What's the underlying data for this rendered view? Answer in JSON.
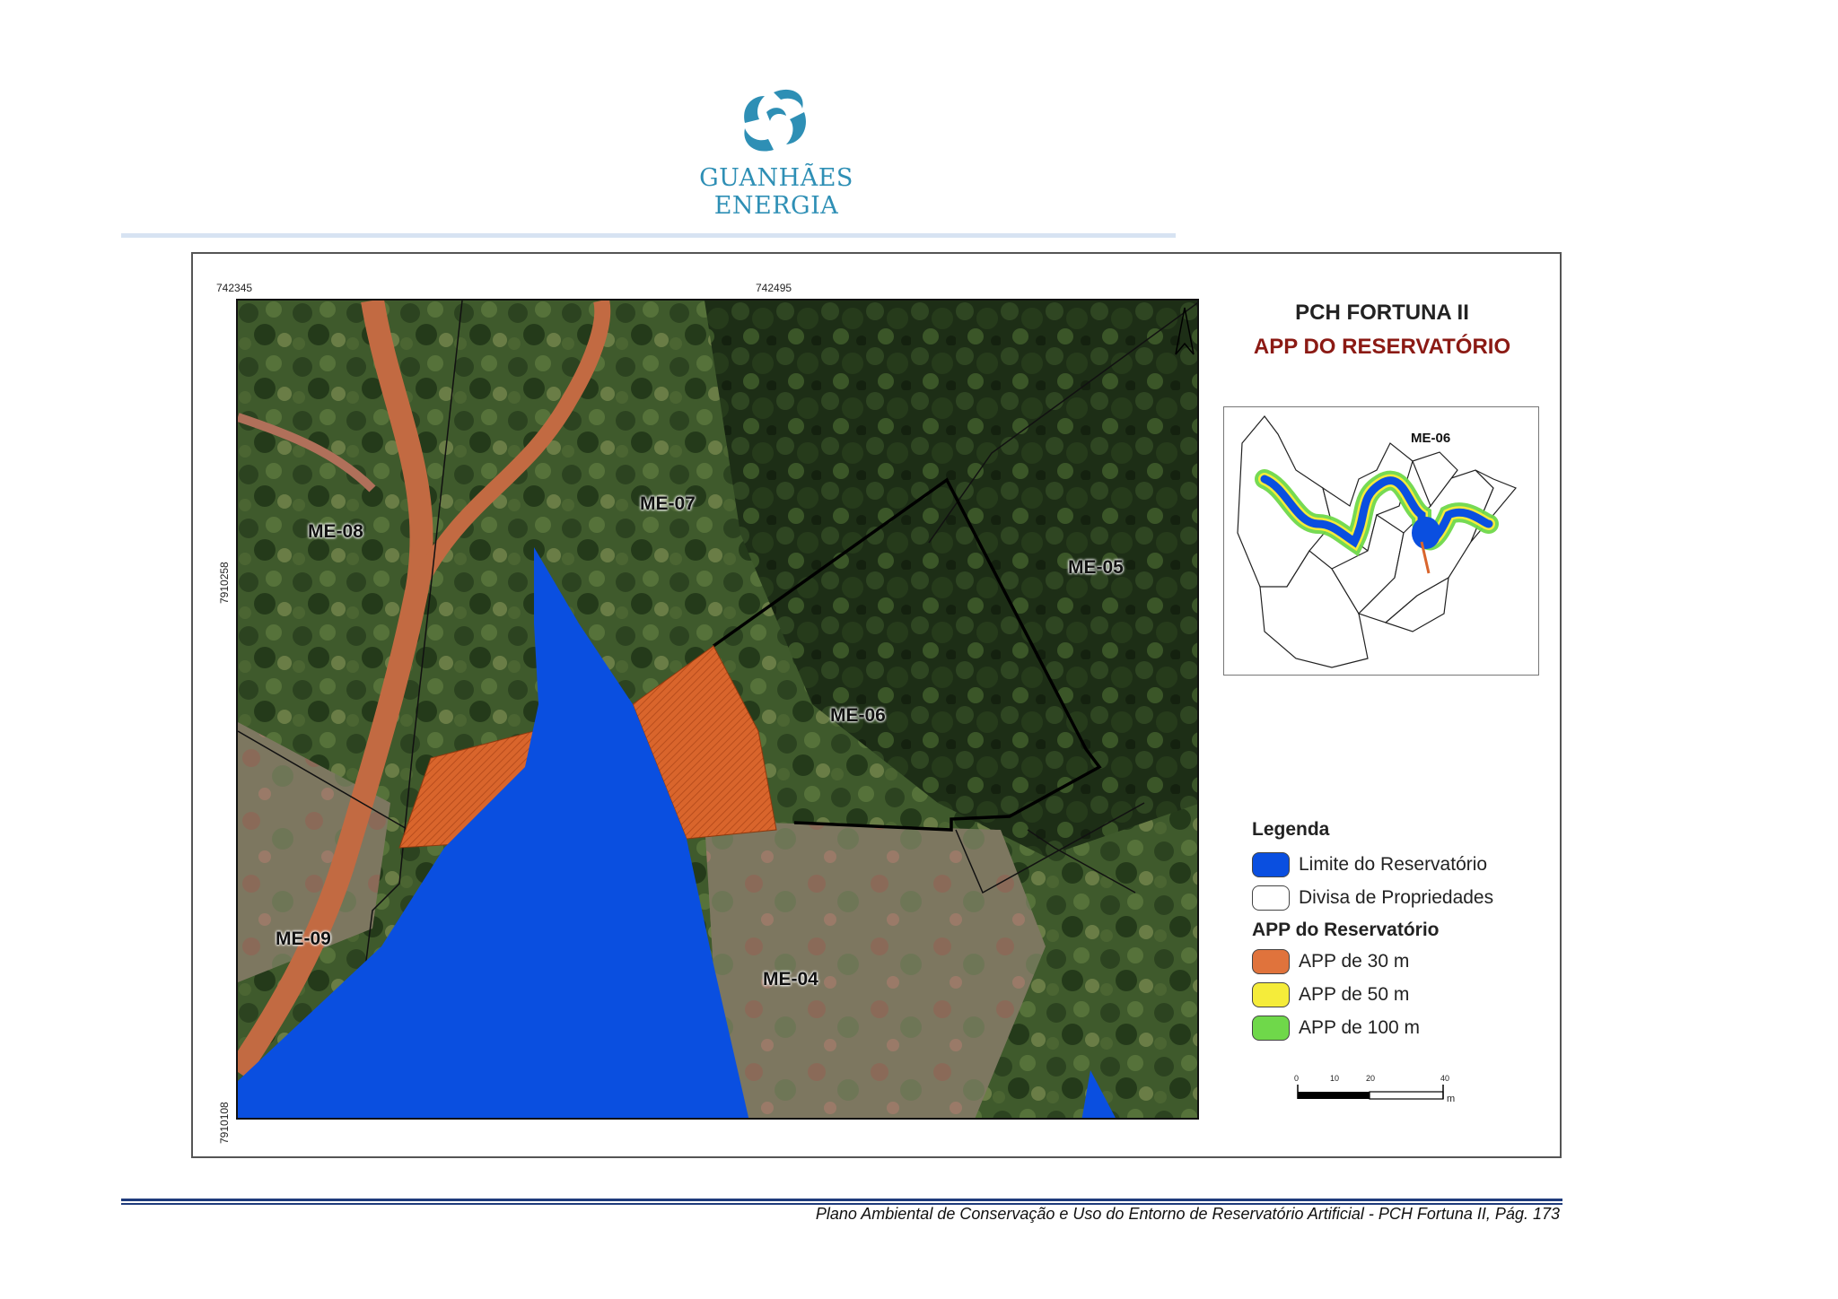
{
  "header": {
    "logo_text": "GUANHÃES ENERGIA",
    "logo_color": "#2e8fb5"
  },
  "map": {
    "title": "PCH FORTUNA II",
    "subtitle": "APP DO RESERVATÓRIO",
    "coords": {
      "x_left": "742345",
      "x_mid": "742495",
      "y_upper": "7910258",
      "y_lower": "7910108"
    },
    "properties": [
      {
        "id": "me08",
        "label": "ME-08"
      },
      {
        "id": "me07",
        "label": "ME-07"
      },
      {
        "id": "me05",
        "label": "ME-05"
      },
      {
        "id": "me06",
        "label": "ME-06"
      },
      {
        "id": "me09",
        "label": "ME-09"
      },
      {
        "id": "me04",
        "label": "ME-04"
      }
    ],
    "inset": {
      "highlight_label": "ME-06"
    },
    "legend": {
      "title": "Legenda",
      "items": [
        {
          "label": "Limite do Reservatório",
          "color": "#0a4fe0"
        },
        {
          "label": "Divisa de Propriedades",
          "color": "#ffffff"
        }
      ],
      "app_title": "APP do Reservatório",
      "app_items": [
        {
          "label": "APP de 30 m",
          "color": "#e0733c"
        },
        {
          "label": "APP de 50 m",
          "color": "#f5ec3a"
        },
        {
          "label": "APP de 100 m",
          "color": "#6fd84a"
        }
      ]
    },
    "scale": {
      "ticks": [
        "0",
        "10",
        "20",
        "40"
      ],
      "unit": "m"
    },
    "colors": {
      "reservoir": "#0a4fe0",
      "app30": "#d9652c"
    }
  },
  "footer": {
    "text": "Plano Ambiental de Conservação e Uso do Entorno de Reservatório Artificial - PCH Fortuna II, Pág. 173"
  }
}
